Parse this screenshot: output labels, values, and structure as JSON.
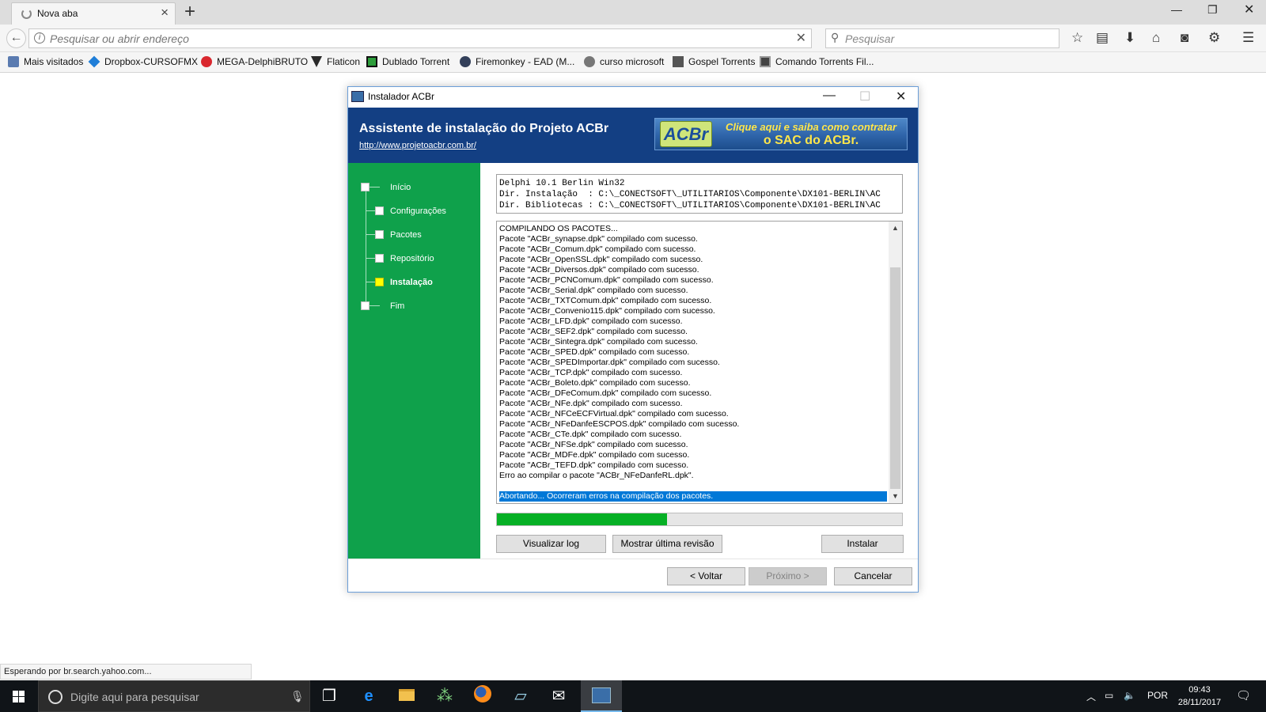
{
  "browser": {
    "tab_title": "Nova aba",
    "url_placeholder": "Pesquisar ou abrir endereço",
    "search_placeholder": "Pesquisar",
    "bookmarks": [
      "Mais visitados",
      "Dropbox-CURSOFMX",
      "MEGA-DelphiBRUTO",
      "Flaticon",
      "Dublado Torrent",
      "Firemonkey - EAD (M...",
      "curso microsoft",
      "Gospel Torrents",
      "Comando Torrents Fil..."
    ],
    "status_text": "Esperando por br.search.yahoo.com..."
  },
  "dialog": {
    "title": "Instalador ACBr",
    "header_title": "Assistente de instalação do Projeto ACBr",
    "header_link": "http://www.projetoacbr.com.br/",
    "banner": {
      "logo": "ACBr",
      "line1": "Clique aqui e saiba como contratar",
      "line2": "o SAC do ACBr."
    },
    "steps": [
      {
        "label": "Início"
      },
      {
        "label": "Configurações"
      },
      {
        "label": "Pacotes"
      },
      {
        "label": "Repositório"
      },
      {
        "label": "Instalação",
        "current": true
      },
      {
        "label": "Fim"
      }
    ],
    "info_lines": [
      "Delphi 10.1 Berlin Win32",
      "Dir. Instalação  : C:\\_CONECTSOFT\\_UTILITARIOS\\Componente\\DX101-BERLIN\\AC",
      "Dir. Bibliotecas : C:\\_CONECTSOFT\\_UTILITARIOS\\Componente\\DX101-BERLIN\\AC"
    ],
    "log_lines": [
      "COMPILANDO OS PACOTES...",
      "Pacote \"ACBr_synapse.dpk\" compilado com sucesso.",
      "Pacote \"ACBr_Comum.dpk\" compilado com sucesso.",
      "Pacote \"ACBr_OpenSSL.dpk\" compilado com sucesso.",
      "Pacote \"ACBr_Diversos.dpk\" compilado com sucesso.",
      "Pacote \"ACBr_PCNComum.dpk\" compilado com sucesso.",
      "Pacote \"ACBr_Serial.dpk\" compilado com sucesso.",
      "Pacote \"ACBr_TXTComum.dpk\" compilado com sucesso.",
      "Pacote \"ACBr_Convenio115.dpk\" compilado com sucesso.",
      "Pacote \"ACBr_LFD.dpk\" compilado com sucesso.",
      "Pacote \"ACBr_SEF2.dpk\" compilado com sucesso.",
      "Pacote \"ACBr_Sintegra.dpk\" compilado com sucesso.",
      "Pacote \"ACBr_SPED.dpk\" compilado com sucesso.",
      "Pacote \"ACBr_SPEDImportar.dpk\" compilado com sucesso.",
      "Pacote \"ACBr_TCP.dpk\" compilado com sucesso.",
      "Pacote \"ACBr_Boleto.dpk\" compilado com sucesso.",
      "Pacote \"ACBr_DFeComum.dpk\" compilado com sucesso.",
      "Pacote \"ACBr_NFe.dpk\" compilado com sucesso.",
      "Pacote \"ACBr_NFCeECFVirtual.dpk\" compilado com sucesso.",
      "Pacote \"ACBr_NFeDanfeESCPOS.dpk\" compilado com sucesso.",
      "Pacote \"ACBr_CTe.dpk\" compilado com sucesso.",
      "Pacote \"ACBr_NFSe.dpk\" compilado com sucesso.",
      "Pacote \"ACBr_MDFe.dpk\" compilado com sucesso.",
      "Pacote \"ACBr_TEFD.dpk\" compilado com sucesso.",
      "Erro ao compilar o pacote \"ACBr_NFeDanfeRL.dpk\"."
    ],
    "log_selected": "Abortando... Ocorreram erros na compilação dos pacotes.",
    "progress_fraction": 0.42,
    "buttons": {
      "view_log": "Visualizar log",
      "show_revision": "Mostrar última revisão",
      "install": "Instalar",
      "back": "< Voltar",
      "next": "Próximo >",
      "cancel": "Cancelar"
    }
  },
  "taskbar": {
    "search_placeholder": "Digite aqui para pesquisar",
    "language": "POR",
    "time": "09:43",
    "date": "28/11/2017"
  }
}
